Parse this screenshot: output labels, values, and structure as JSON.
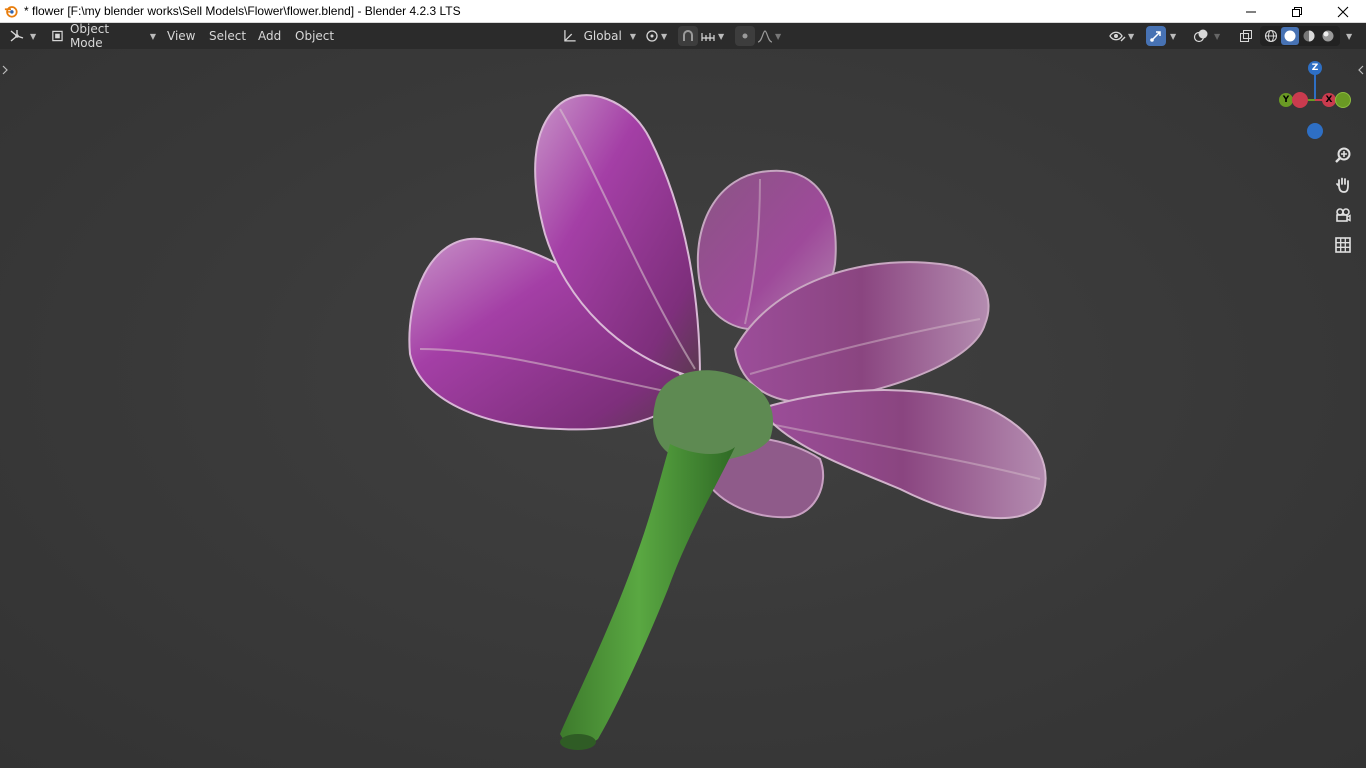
{
  "window": {
    "title": "* flower [F:\\my blender works\\Sell Models\\Flower\\flower.blend] - Blender 4.2.3 LTS"
  },
  "header": {
    "mode_label": "Object Mode",
    "menus": [
      "View",
      "Select",
      "Add",
      "Object"
    ],
    "transform_orientation": "Global"
  },
  "gizmo": {
    "z_label": "Z",
    "y_label": "Y",
    "x_label": "X"
  },
  "colors": {
    "viewport_bg": "#3a3a3a",
    "header_bg": "#2b2b2b",
    "accent": "#4772b3",
    "axis_x": "#c93b4e",
    "axis_y": "#6a9a24",
    "axis_z": "#2e6fc4",
    "petal": "#9b3fa0",
    "stem": "#4f9a3a"
  },
  "icons": [
    "blender-logo-icon",
    "editor-type-icon",
    "object-mode-icon",
    "transform-orientation-icon",
    "pivot-icon",
    "snap-icon",
    "snap-increment-icon",
    "proportional-edit-icon",
    "falloff-icon",
    "visibility-icon",
    "gizmo-icon",
    "overlay-icon",
    "xray-icon",
    "wireframe-shading-icon",
    "solid-shading-icon",
    "material-shading-icon",
    "rendered-shading-icon",
    "zoom-icon",
    "pan-hand-icon",
    "camera-view-icon",
    "grid-view-icon",
    "minimize-icon",
    "restore-icon",
    "close-icon"
  ]
}
